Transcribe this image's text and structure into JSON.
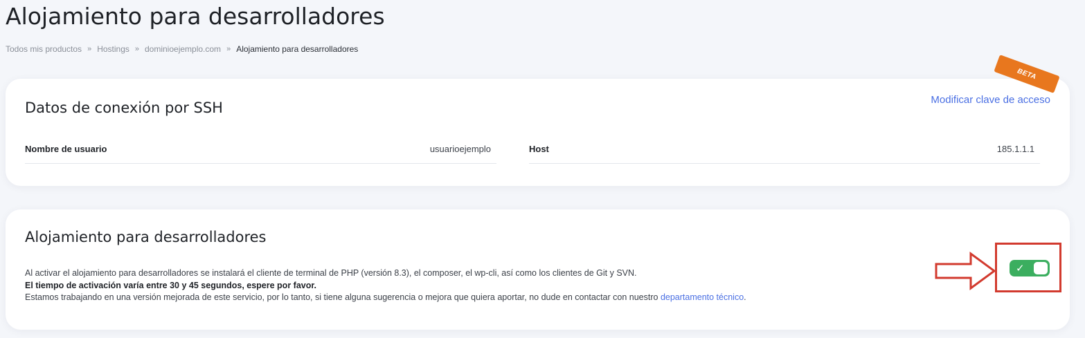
{
  "page": {
    "title": "Alojamiento para desarrolladores"
  },
  "breadcrumb": {
    "items": [
      "Todos mis productos",
      "Hostings",
      "dominioejemplo.com"
    ],
    "separator": "»",
    "current": "Alojamiento para desarrolladores"
  },
  "ssh_card": {
    "title": "Datos de conexión por SSH",
    "modify_link": "Modificar clave de acceso",
    "badge": "BETA",
    "username_label": "Nombre de usuario",
    "username_value": "usuarioejemplo",
    "host_label": "Host",
    "host_value": "185.1.1.1"
  },
  "dev_card": {
    "title": "Alojamiento para desarrolladores",
    "line1": "Al activar el alojamiento para desarrolladores se instalará el cliente de terminal de PHP (versión 8.3), el composer, el wp-cli, así como los clientes de Git y SVN.",
    "line2": "El tiempo de activación varía entre 30 y 45 segundos, espere por favor.",
    "line3_prefix": "Estamos trabajando en una versión mejorada de este servicio, por lo tanto, si tiene alguna sugerencia o mejora que quiera aportar, no dude en contactar con nuestro ",
    "line3_link": "departamento técnico",
    "line3_suffix": ".",
    "toggle_state": "on",
    "toggle_icon": "check-icon"
  },
  "colors": {
    "accent_link": "#4a6fe3",
    "toggle_on": "#3bae5f",
    "beta_badge": "#e8771e",
    "annotation": "#d23a2e"
  }
}
